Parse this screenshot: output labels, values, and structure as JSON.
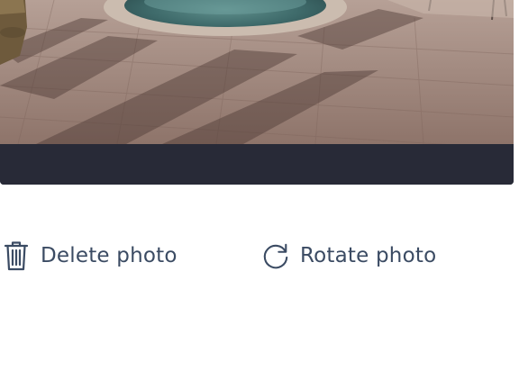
{
  "photo": {
    "subject": "pool-patio-image",
    "bar_color": "#282a37"
  },
  "actions": {
    "delete_label": "Delete photo",
    "delete_icon": "trash-icon",
    "rotate_label": "Rotate photo",
    "rotate_icon": "rotate-icon",
    "text_color": "#3b4b63"
  }
}
